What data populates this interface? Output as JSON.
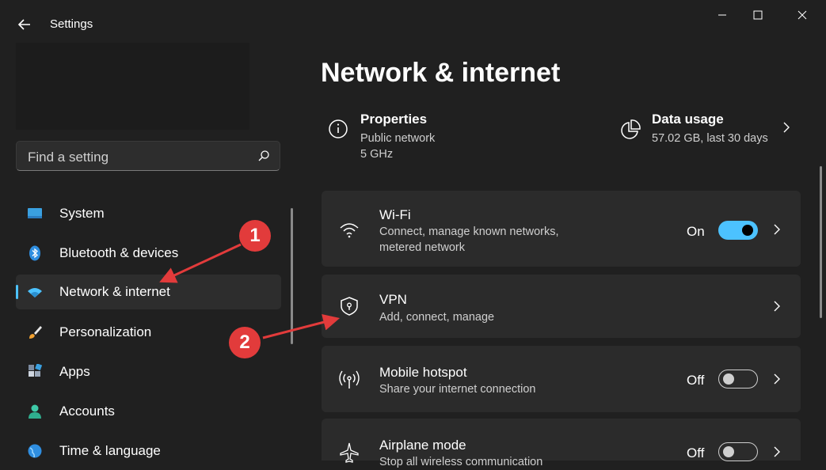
{
  "window": {
    "title": "Settings"
  },
  "search": {
    "placeholder": "Find a setting"
  },
  "sidebar": {
    "items": [
      {
        "label": "System",
        "icon": "monitor-icon"
      },
      {
        "label": "Bluetooth & devices",
        "icon": "bluetooth-icon"
      },
      {
        "label": "Network & internet",
        "icon": "wifi-icon",
        "active": true
      },
      {
        "label": "Personalization",
        "icon": "brush-icon"
      },
      {
        "label": "Apps",
        "icon": "apps-icon"
      },
      {
        "label": "Accounts",
        "icon": "person-icon"
      },
      {
        "label": "Time & language",
        "icon": "globe-icon"
      }
    ]
  },
  "main": {
    "title": "Network & internet",
    "properties": {
      "title": "Properties",
      "network": "Public network",
      "band": "5 GHz"
    },
    "data_usage": {
      "title": "Data usage",
      "value": "57.02 GB, last 30 days"
    },
    "cards": [
      {
        "title": "Wi-Fi",
        "desc_line1": "Connect, manage known networks,",
        "desc_line2": "metered network",
        "state": "On",
        "toggle_on": true,
        "icon": "wifi-icon"
      },
      {
        "title": "VPN",
        "desc_line1": "Add, connect, manage",
        "icon": "shield-icon"
      },
      {
        "title": "Mobile hotspot",
        "desc_line1": "Share your internet connection",
        "state": "Off",
        "toggle_on": false,
        "icon": "hotspot-icon"
      },
      {
        "title": "Airplane mode",
        "desc_line1": "Stop all wireless communication",
        "state": "Off",
        "toggle_on": false,
        "icon": "airplane-icon"
      }
    ]
  },
  "annotations": {
    "badge1": "1",
    "badge2": "2"
  },
  "colors": {
    "accent": "#4cc2ff",
    "background": "#202020",
    "card": "#2b2b2b",
    "annotation": "#e23b3b"
  }
}
